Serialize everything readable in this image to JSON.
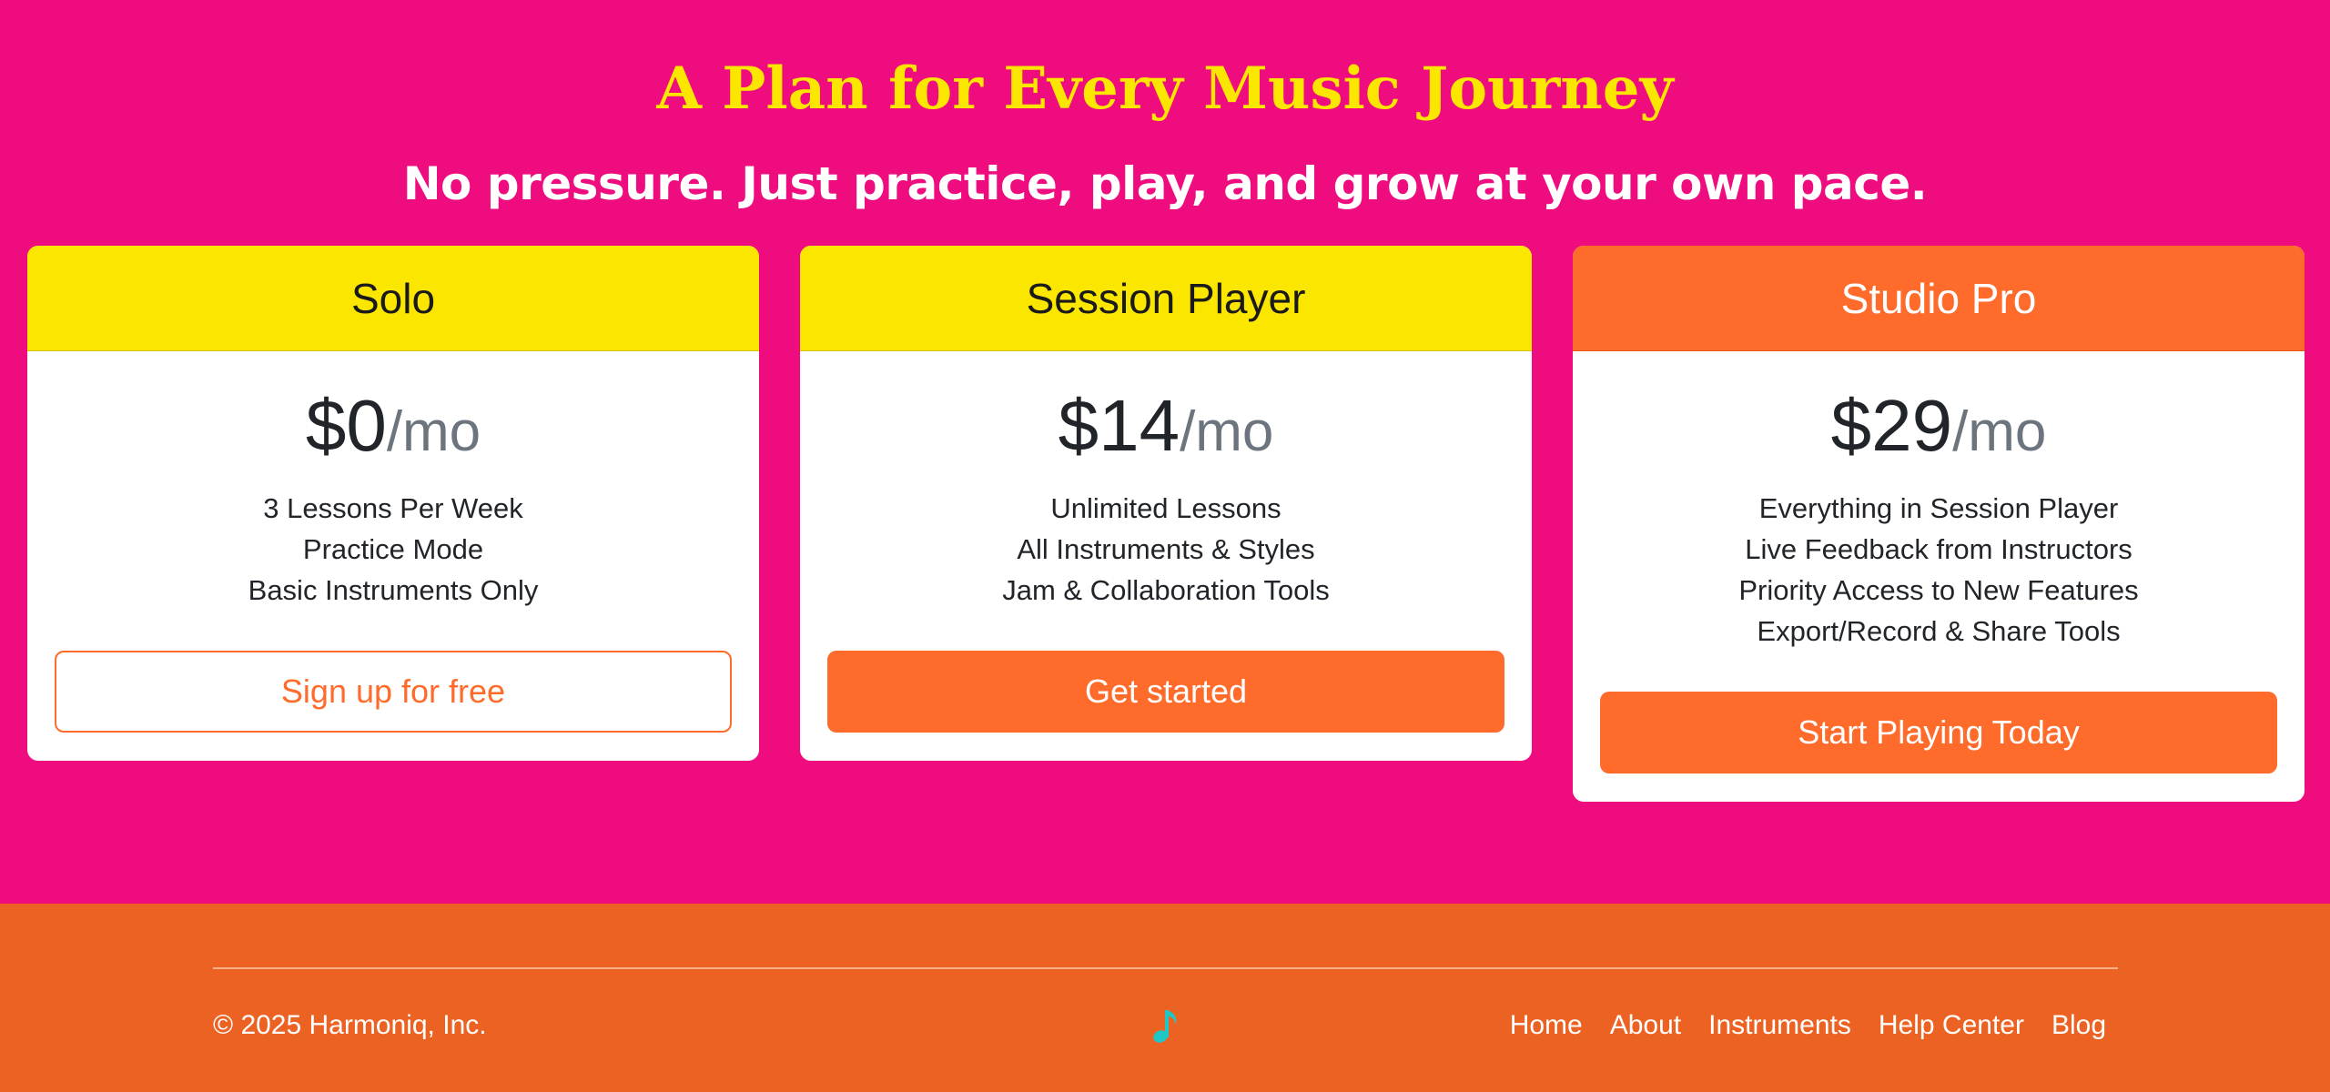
{
  "hero": {
    "headline": "A Plan for Every Music Journey",
    "subheadline": "No pressure. Just practice, play, and grow at your own pace."
  },
  "plans": [
    {
      "name": "Solo",
      "price": "$0",
      "period": "/mo",
      "features": [
        "3 Lessons Per Week",
        "Practice Mode",
        "Basic Instruments Only"
      ],
      "cta": "Sign up for free"
    },
    {
      "name": "Session Player",
      "price": "$14",
      "period": "/mo",
      "features": [
        "Unlimited Lessons",
        "All Instruments & Styles",
        "Jam & Collaboration Tools"
      ],
      "cta": "Get started"
    },
    {
      "name": "Studio Pro",
      "price": "$29",
      "period": "/mo",
      "features": [
        "Everything in Session Player",
        "Live Feedback from Instructors",
        "Priority Access to New Features",
        "Export/Record & Share Tools"
      ],
      "cta": "Start Playing Today"
    }
  ],
  "footer": {
    "copyright": "© 2025 Harmoniq, Inc.",
    "icon": "music-note-icon",
    "links": [
      "Home",
      "About",
      "Instruments",
      "Help Center",
      "Blog"
    ]
  },
  "colors": {
    "background": "#ee0c7f",
    "accent_yellow": "#fbe600",
    "accent_orange": "#ff6b2b",
    "footer": "#ec6222",
    "icon_teal": "#20c7c7"
  }
}
